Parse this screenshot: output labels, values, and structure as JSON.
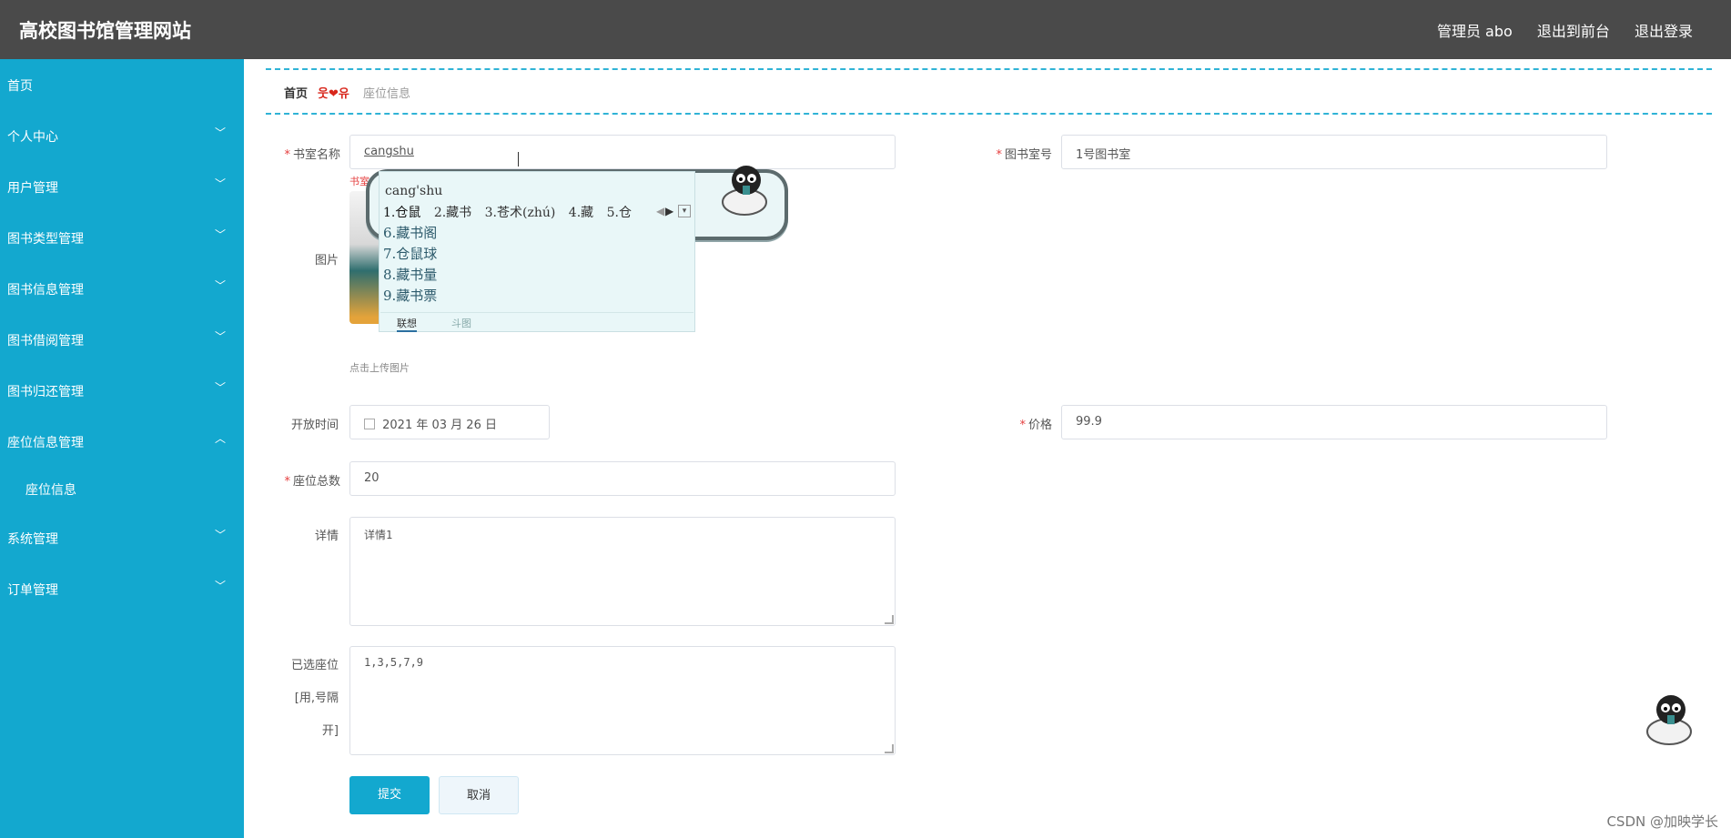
{
  "header": {
    "title": "高校图书馆管理网站",
    "admin": "管理员 abo",
    "front": "退出到前台",
    "logout": "退出登录"
  },
  "sidebar": {
    "items": [
      {
        "label": "首页",
        "expand": ""
      },
      {
        "label": "个人中心",
        "expand": "﹀"
      },
      {
        "label": "用户管理",
        "expand": "﹀"
      },
      {
        "label": "图书类型管理",
        "expand": "﹀"
      },
      {
        "label": "图书信息管理",
        "expand": "﹀"
      },
      {
        "label": "图书借阅管理",
        "expand": "﹀"
      },
      {
        "label": "图书归还管理",
        "expand": "﹀"
      },
      {
        "label": "座位信息管理",
        "expand": "︿"
      },
      {
        "label": "座位信息",
        "expand": ""
      },
      {
        "label": "系统管理",
        "expand": "﹀"
      },
      {
        "label": "订单管理",
        "expand": "﹀"
      }
    ]
  },
  "breadcrumb": {
    "home": "首页",
    "separator": "웃❤유",
    "current": "座位信息"
  },
  "form": {
    "room_name_label": "书室名称",
    "room_name_value": "cangshu",
    "room_name_error": "书室",
    "room_no_label": "图书室号",
    "room_no_value": "1号图书室",
    "image_label": "图片",
    "upload_hint": "点击上传图片",
    "open_time_label": "开放时间",
    "open_time_value": "2021 年 03 月 26 日",
    "price_label": "价格",
    "price_value": "99.9",
    "seats_total_label": "座位总数",
    "seats_total_value": "20",
    "detail_label": "详情",
    "detail_value": "详情1",
    "selected_seats_label_1": "已选座位",
    "selected_seats_label_2": "[用,号隔",
    "selected_seats_label_3": "开]",
    "selected_seats_value": "1,3,5,7,9",
    "submit": "提交",
    "cancel": "取消"
  },
  "ime": {
    "pinyin": "cang'shu",
    "row1": [
      "1.仓鼠",
      "2.藏书",
      "3.苍术(zhú)",
      "4.藏",
      "5.仓"
    ],
    "list": [
      "6.藏书阁",
      "7.仓鼠球",
      "8.藏书量",
      "9.藏书票"
    ],
    "tab_assoc": "联想",
    "tab_meme": "斗图"
  },
  "watermark": "CSDN @加映学长",
  "colors": {
    "sidebar": "#13a8cf",
    "topbar": "#4a4a4a",
    "accent": "#13a8cf",
    "required": "#e53e3e"
  }
}
